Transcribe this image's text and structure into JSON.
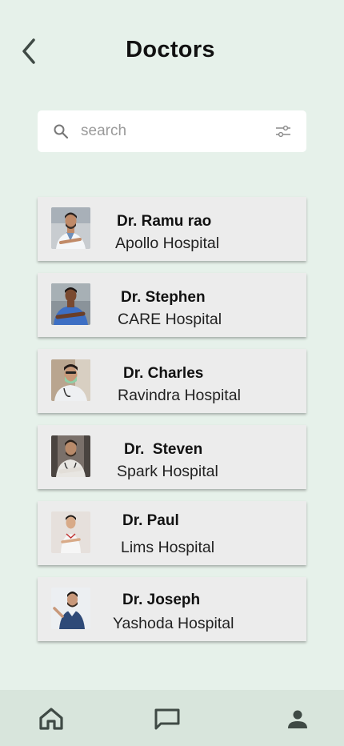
{
  "header": {
    "title": "Doctors"
  },
  "search": {
    "placeholder": "search"
  },
  "doctors": [
    {
      "name": "Dr. Ramu rao",
      "hospital": "Apollo Hospital"
    },
    {
      "name": "Dr. Stephen",
      "hospital": "CARE Hospital"
    },
    {
      "name": "Dr. Charles",
      "hospital": "Ravindra Hospital"
    },
    {
      "name": "Dr.  Steven",
      "hospital": "Spark Hospital"
    },
    {
      "name": "Dr. Paul",
      "hospital": "Lims Hospital"
    },
    {
      "name": "Dr. Joseph",
      "hospital": "Yashoda Hospital"
    }
  ],
  "icons": {
    "back": "chevron-left-icon",
    "search": "search-icon",
    "filter": "filter-sliders-icon",
    "home": "home-icon",
    "messages": "chat-bubble-icon",
    "profile": "user-icon"
  },
  "colors": {
    "background": "#e6f1ea",
    "card": "#ececec",
    "nav": "#d8e5dc",
    "icon": "#3f4a45"
  }
}
